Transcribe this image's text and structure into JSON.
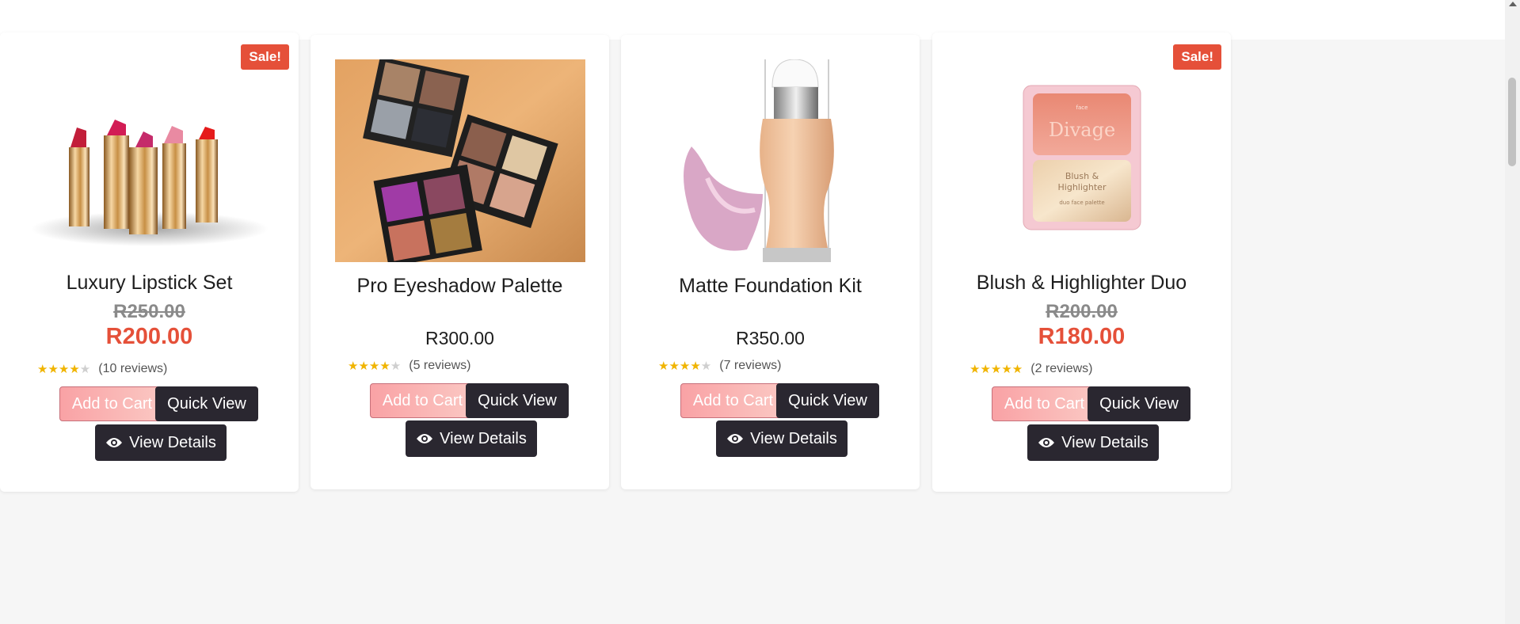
{
  "products": [
    {
      "badge": "Sale!",
      "title": "Luxury Lipstick Set",
      "old_price": "R250.00",
      "price": "R200.00",
      "rating": 4,
      "reviews": "(10 reviews)",
      "add_to_cart": "Add to Cart",
      "quick_view": "Quick View",
      "view_details": "View Details"
    },
    {
      "title": "Pro Eyeshadow Palette",
      "price": "R300.00",
      "rating": 4,
      "reviews": "(5 reviews)",
      "add_to_cart": "Add to Cart",
      "quick_view": "Quick View",
      "view_details": "View Details"
    },
    {
      "title": "Matte Foundation Kit",
      "price": "R350.00",
      "rating": 4,
      "reviews": "(7 reviews)",
      "add_to_cart": "Add to Cart",
      "quick_view": "Quick View",
      "view_details": "View Details"
    },
    {
      "badge": "Sale!",
      "title": "Blush & Highlighter Duo",
      "old_price": "R200.00",
      "price": "R180.00",
      "rating": 5,
      "reviews": "(2 reviews)",
      "add_to_cart": "Add to Cart",
      "quick_view": "Quick View",
      "view_details": "View Details"
    }
  ],
  "blush_palette": {
    "brand": "Divage",
    "top": "face",
    "line1": "Blush &",
    "line2": "Highlighter",
    "line3": "duo face palette"
  },
  "colors": {
    "sale": "#e55039",
    "dark_button": "#2a2730",
    "cart_button": "#f9a2a5",
    "star": "#f0b400"
  }
}
